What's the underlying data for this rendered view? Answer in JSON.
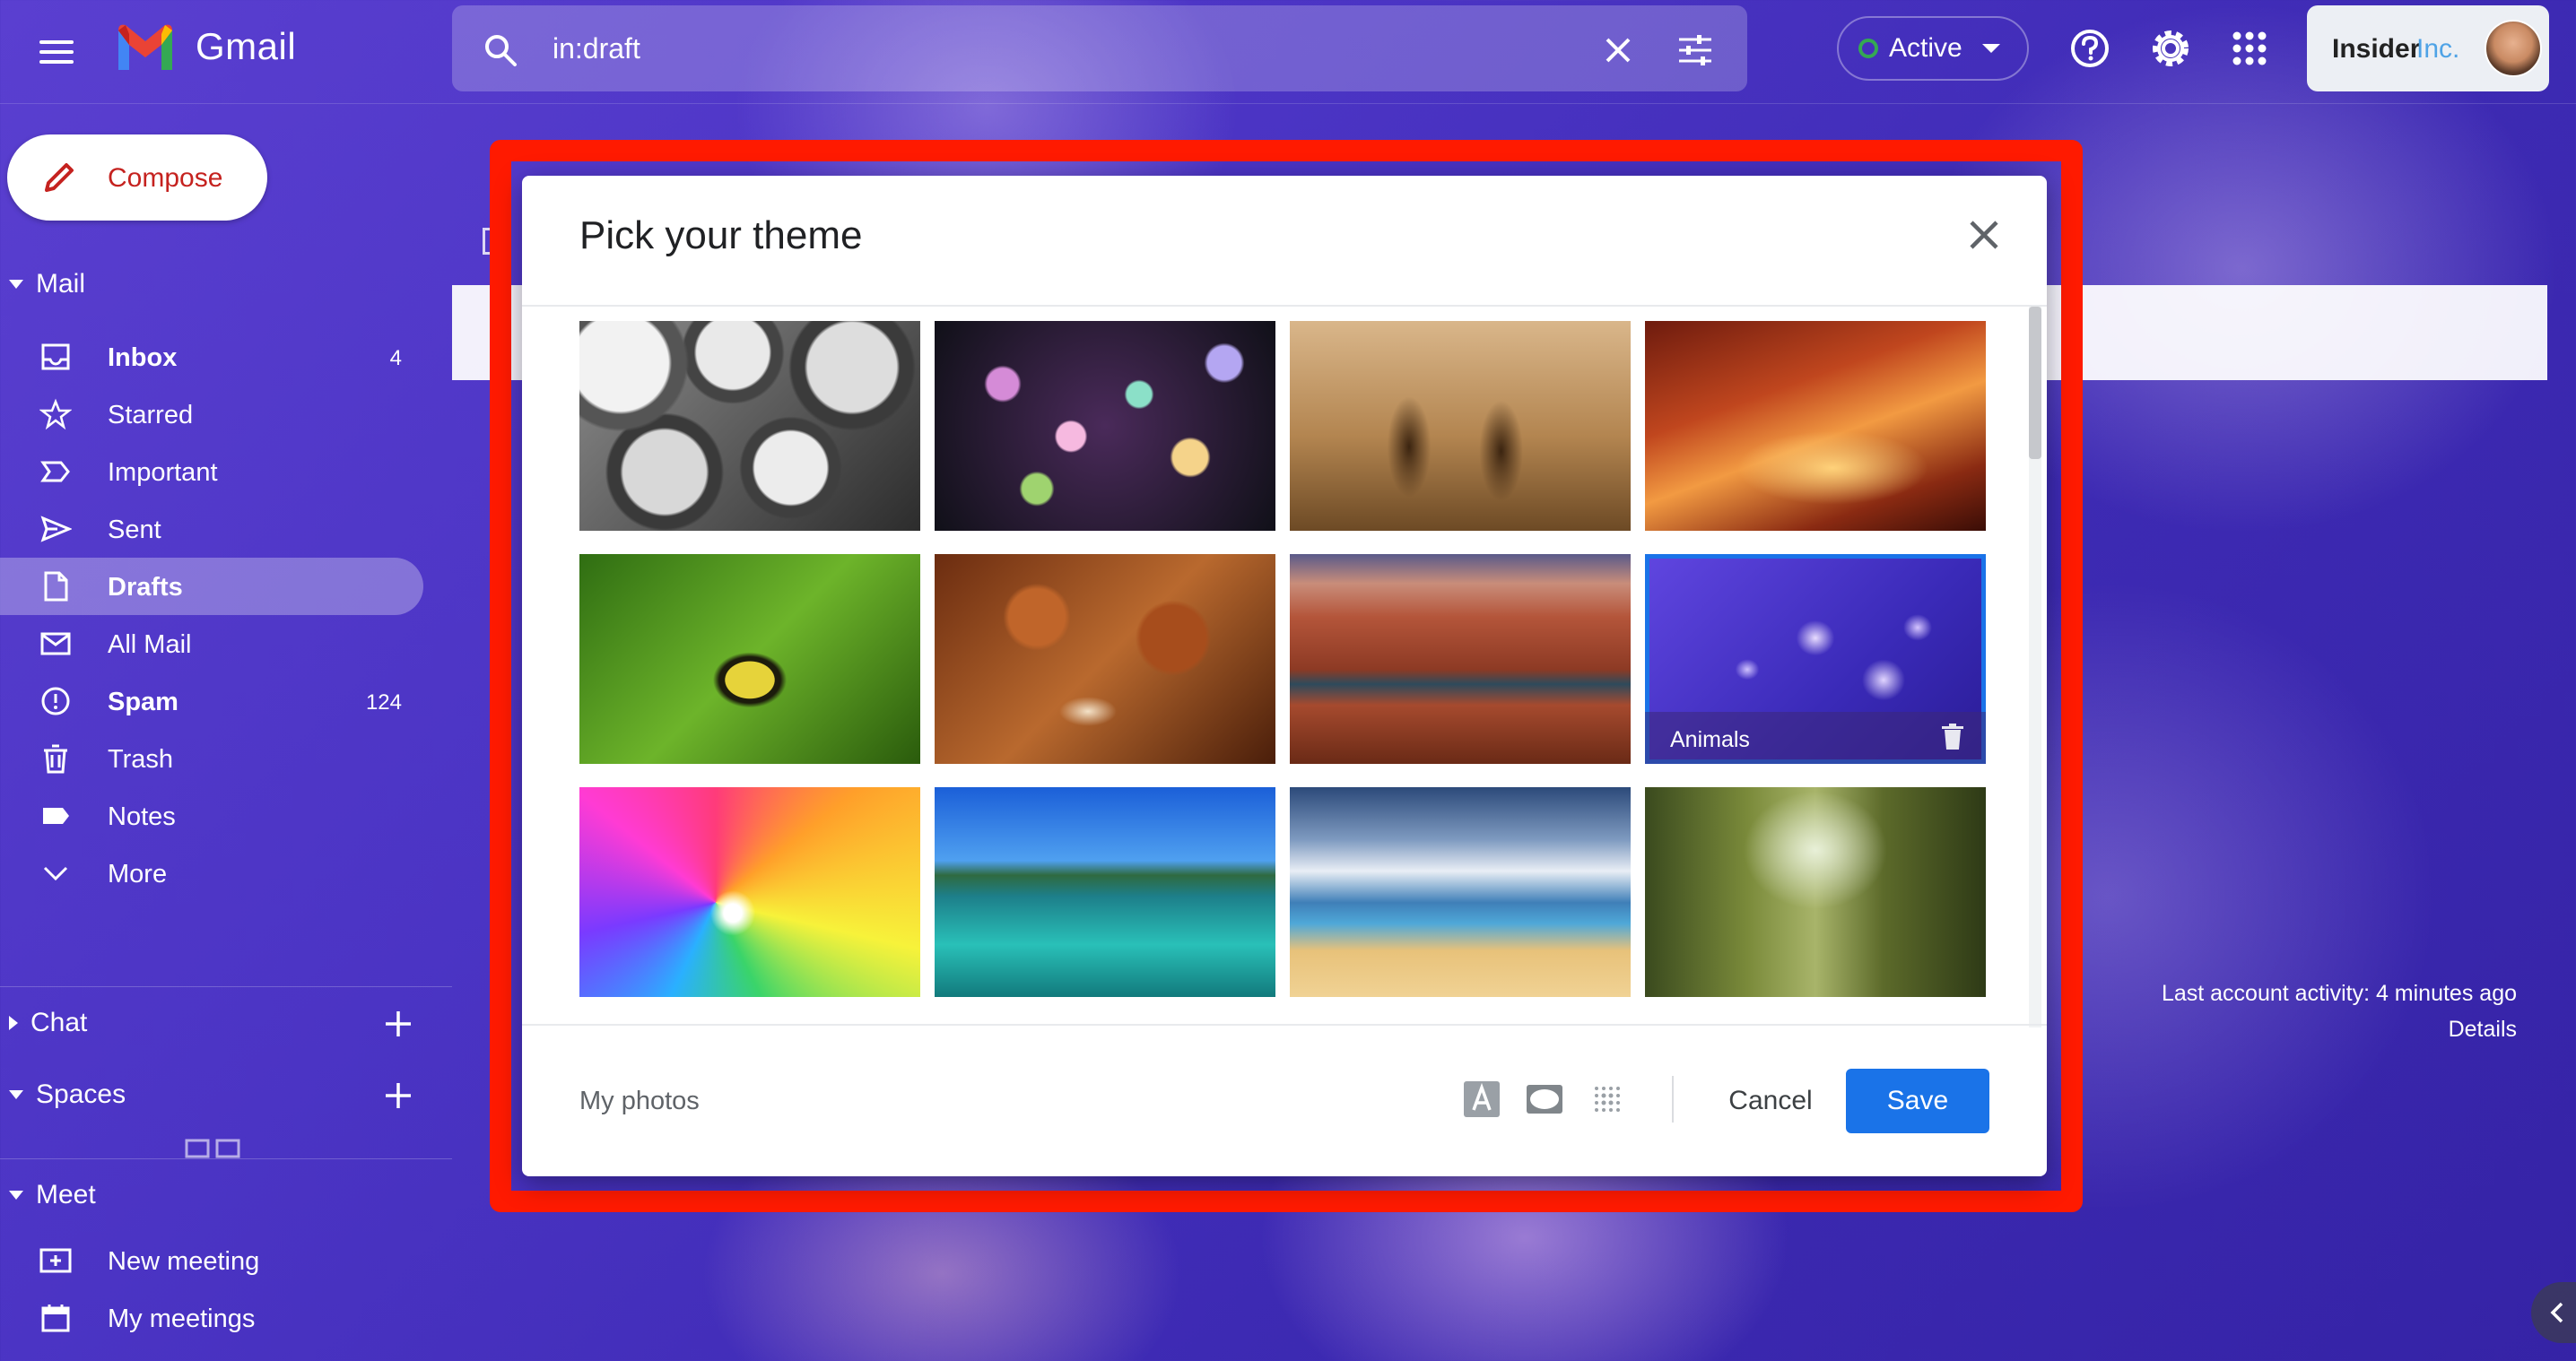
{
  "app": {
    "name": "Gmail"
  },
  "search": {
    "value": "in:draft"
  },
  "status": {
    "label": "Active",
    "color": "#34a853"
  },
  "account": {
    "brand_primary": "Insider",
    "brand_secondary": "Inc."
  },
  "compose": {
    "label": "Compose"
  },
  "mail_section": {
    "title": "Mail"
  },
  "nav": [
    {
      "label": "Inbox",
      "count": "4",
      "icon": "inbox-icon",
      "bold": true
    },
    {
      "label": "Starred",
      "count": "",
      "icon": "star-icon"
    },
    {
      "label": "Important",
      "count": "",
      "icon": "important-icon"
    },
    {
      "label": "Sent",
      "count": "",
      "icon": "send-icon"
    },
    {
      "label": "Drafts",
      "count": "",
      "icon": "draft-icon",
      "bold": true,
      "active": true
    },
    {
      "label": "All Mail",
      "count": "",
      "icon": "mail-icon"
    },
    {
      "label": "Spam",
      "count": "124",
      "icon": "spam-icon",
      "bold": true
    },
    {
      "label": "Trash",
      "count": "",
      "icon": "trash-icon"
    },
    {
      "label": "Notes",
      "count": "",
      "icon": "label-icon"
    },
    {
      "label": "More",
      "count": "",
      "icon": "chevron-down-icon"
    }
  ],
  "chat_section": {
    "title": "Chat"
  },
  "spaces_section": {
    "title": "Spaces"
  },
  "meet_section": {
    "title": "Meet",
    "items": [
      {
        "label": "New meeting",
        "icon": "video-plus-icon"
      },
      {
        "label": "My meetings",
        "icon": "calendar-icon"
      }
    ]
  },
  "footer": {
    "last_activity": "Last account activity: 4 minutes ago",
    "details": "Details"
  },
  "dialog": {
    "title": "Pick your theme",
    "themes": [
      {
        "scene": "metal-pipes"
      },
      {
        "scene": "bokeh-lights"
      },
      {
        "scene": "chess-pieces"
      },
      {
        "scene": "red-canyon"
      },
      {
        "scene": "caterpillar"
      },
      {
        "scene": "autumn-leaves"
      },
      {
        "scene": "grand-canyon"
      },
      {
        "scene": "jellyfish",
        "label": "Animals",
        "selected": true
      },
      {
        "scene": "rainbow-water"
      },
      {
        "scene": "lake-shore"
      },
      {
        "scene": "beach"
      },
      {
        "scene": "forest"
      },
      {
        "scene": "partial"
      },
      {
        "scene": "partial"
      },
      {
        "scene": "partial"
      },
      {
        "scene": "partial"
      }
    ],
    "my_photos": "My photos",
    "cancel": "Cancel",
    "save": "Save",
    "accent_color": "#1a73e8"
  },
  "highlight_color": "#ff1a00"
}
